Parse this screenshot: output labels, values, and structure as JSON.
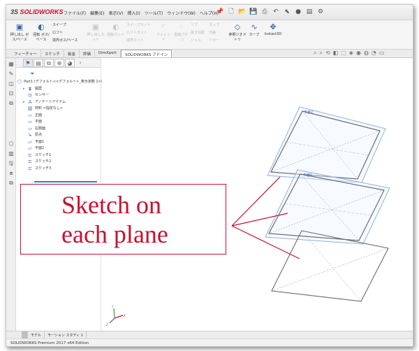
{
  "app": {
    "logo_brand": "SOLIDWORKS",
    "logo_prefix": "3S",
    "menus": [
      "ファイル(F)",
      "編集(E)",
      "表示(V)",
      "挿入(I)",
      "ツール(T)",
      "ウィンドウ(W)",
      "ヘルプ(H)"
    ]
  },
  "ribbon": {
    "buttons": [
      {
        "label": "押し出し ボス/ベース",
        "enabled": true
      },
      {
        "label": "回転 ボス/ベース",
        "enabled": true
      },
      {
        "label": "スイープ",
        "enabled": true
      },
      {
        "label": "ロフト",
        "enabled": true
      },
      {
        "label": "境界ボス/ベース",
        "enabled": true
      },
      {
        "label": "押し出しカット",
        "enabled": false
      },
      {
        "label": "回転カット",
        "enabled": false
      },
      {
        "label": "スイープカット",
        "enabled": false
      },
      {
        "label": "ロフトカット",
        "enabled": false
      },
      {
        "label": "境界カット",
        "enabled": false
      },
      {
        "label": "フィレット",
        "enabled": false
      },
      {
        "label": "直線パターン",
        "enabled": false
      },
      {
        "label": "リブ",
        "enabled": false
      },
      {
        "label": "抜き勾配",
        "enabled": false
      },
      {
        "label": "シェル",
        "enabled": false
      },
      {
        "label": "ラップ",
        "enabled": false
      },
      {
        "label": "交差",
        "enabled": false
      },
      {
        "label": "ミラー",
        "enabled": false
      },
      {
        "label": "参照ジオメトリ",
        "enabled": true
      },
      {
        "label": "カーブ",
        "enabled": true
      },
      {
        "label": "Instant3D",
        "enabled": true
      }
    ]
  },
  "command_tabs": [
    "フィーチャー",
    "スケッチ",
    "板金",
    "評価",
    "DimXpert",
    "SOLIDWORKS アドイン"
  ],
  "feature_tree": {
    "nodes": [
      {
        "label": "Part1  (デフォルト<<デフォルト>_表示状態 1>)",
        "icon": "part-icon",
        "toggle": ""
      },
      {
        "label": "履歴",
        "icon": "history-icon",
        "toggle": "▸"
      },
      {
        "label": "センサー",
        "icon": "sensor-icon",
        "toggle": ""
      },
      {
        "label": "アノテートアイテム",
        "icon": "annotation-icon",
        "toggle": "▸"
      },
      {
        "label": "材料 <指定なし>",
        "icon": "material-icon",
        "toggle": ""
      },
      {
        "label": "正面",
        "icon": "plane-icon",
        "toggle": ""
      },
      {
        "label": "平面",
        "icon": "plane-icon",
        "toggle": ""
      },
      {
        "label": "右側面",
        "icon": "plane-icon",
        "toggle": ""
      },
      {
        "label": "原点",
        "icon": "origin-icon",
        "toggle": ""
      },
      {
        "label": "平面1",
        "icon": "plane-icon",
        "toggle": ""
      },
      {
        "label": "平面2",
        "icon": "plane-icon",
        "toggle": ""
      },
      {
        "label": "スケッチ1",
        "icon": "sketch-icon",
        "toggle": ""
      },
      {
        "label": "スケッチ2",
        "icon": "sketch-icon",
        "toggle": ""
      },
      {
        "label": "スケッチ3",
        "icon": "sketch-icon",
        "toggle": ""
      }
    ]
  },
  "viewport": {
    "plane_labels": [
      "平面2",
      "平面1"
    ],
    "triad_axis_labels": [
      "X",
      "Y",
      "Z"
    ]
  },
  "bottom_tabs": [
    "",
    "モデル",
    "モーション スタディ 1"
  ],
  "status": {
    "text": "SOLIDWORKS Premium 2017 x64 Edition"
  },
  "callout": {
    "line1": "Sketch on",
    "line2": "each plane",
    "color": "#c8102e"
  }
}
